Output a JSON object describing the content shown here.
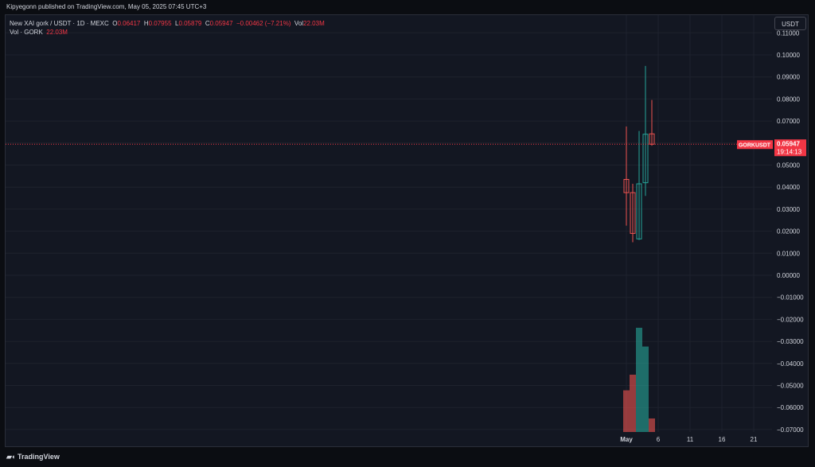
{
  "header": {
    "publish_line": "Kipyegonn published on TradingView.com, May 05, 2025 07:45 UTC+3"
  },
  "legend": {
    "symbol": "New XAI gork / USDT · 1D · MEXC",
    "open_label": "O",
    "open": "0.06417",
    "high_label": "H",
    "high": "0.07955",
    "low_label": "L",
    "low": "0.05879",
    "close_label": "C",
    "close": "0.05947",
    "change": "−0.00462 (−7.21%)",
    "vol_label": "Vol",
    "vol": "22.03M",
    "vol_line_label": "Vol · GORK",
    "vol_line_value": "22.03M"
  },
  "quote_currency": "USDT",
  "price_tag": {
    "symbol": "GORKUSDT",
    "price": "0.05947",
    "countdown": "19:14:13"
  },
  "footer": {
    "brand": "TradingView",
    "brand_icon": "tradingview-logo-icon"
  },
  "colors": {
    "up": "#26a69a",
    "down": "#ef5350",
    "price_line": "#f23645",
    "background": "#131722",
    "grid": "#1e222d",
    "text": "#d1d4dc"
  },
  "chart_data": {
    "type": "candlestick",
    "title": "",
    "y_axis": {
      "min": -0.075,
      "max": 0.11,
      "ticks": [
        "0.11000",
        "0.10000",
        "0.09000",
        "0.08000",
        "0.07000",
        "0.06000",
        "0.05000",
        "0.04000",
        "0.03000",
        "0.02000",
        "0.01000",
        "0.00000",
        "−0.01000",
        "−0.02000",
        "−0.03000",
        "−0.04000",
        "−0.05000",
        "−0.06000",
        "−0.07000"
      ]
    },
    "x_axis": {
      "ticks": [
        {
          "label": "May",
          "day": 1
        },
        {
          "label": "6",
          "day": 6
        },
        {
          "label": "11",
          "day": 11
        },
        {
          "label": "16",
          "day": 16
        },
        {
          "label": "21",
          "day": 21
        }
      ]
    },
    "candles": [
      {
        "day": 1,
        "open": 0.0435,
        "high": 0.0675,
        "low": 0.0225,
        "close": 0.0375,
        "volume": 0.4
      },
      {
        "day": 2,
        "open": 0.0375,
        "high": 0.0415,
        "low": 0.015,
        "close": 0.019,
        "volume": 0.55
      },
      {
        "day": 3,
        "open": 0.0165,
        "high": 0.0655,
        "low": 0.016,
        "close": 0.0415,
        "volume": 1.0
      },
      {
        "day": 4,
        "open": 0.042,
        "high": 0.095,
        "low": 0.036,
        "close": 0.064,
        "volume": 0.82
      },
      {
        "day": 5,
        "open": 0.06417,
        "high": 0.07955,
        "low": 0.05879,
        "close": 0.05947,
        "volume": 0.13
      }
    ],
    "last_price": 0.05947
  }
}
